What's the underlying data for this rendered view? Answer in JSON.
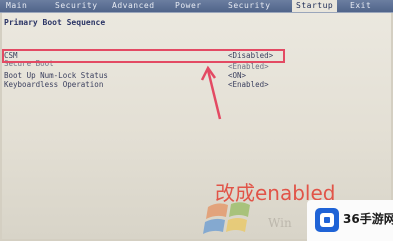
{
  "tabs": [
    {
      "label": "Main"
    },
    {
      "label": "Security"
    },
    {
      "label": "Advanced"
    },
    {
      "label": "Power"
    },
    {
      "label": "Security"
    },
    {
      "label": "Startup"
    },
    {
      "label": "Exit"
    }
  ],
  "active_tab": "Startup",
  "section_title": "Primary Boot Sequence",
  "rows": [
    {
      "label": "CSM",
      "value": "<Disabled>"
    },
    {
      "label": "Secure Boot",
      "value": "<Enabled>"
    },
    {
      "label": "Boot Up Num-Lock Status",
      "value": "<ON>"
    },
    {
      "label": "Keyboardless Operation",
      "value": "<Enabled>"
    }
  ],
  "annotation": "改成enabled",
  "watermark_text": "Win",
  "site_logo_text": "36手游网",
  "colors": {
    "highlight": "#e34a63",
    "annotation": "#e2463a",
    "tab_bar": "#5a6e94",
    "logo_blue": "#1f63d6"
  }
}
